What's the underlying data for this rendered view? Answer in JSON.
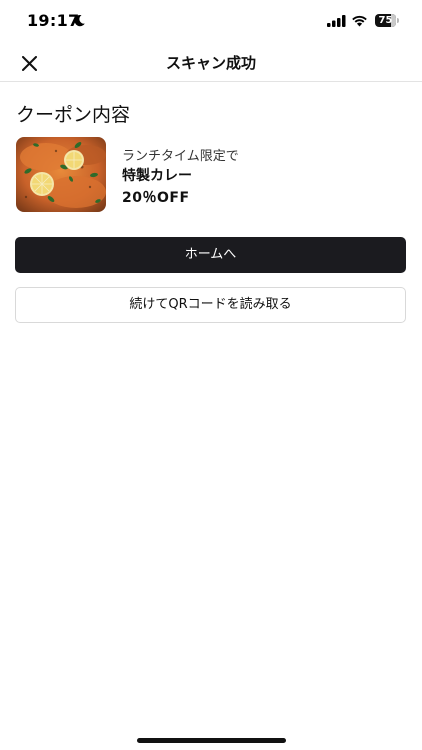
{
  "status_bar": {
    "time": "19:17",
    "battery": "75",
    "battery_level": 0.75
  },
  "nav": {
    "title": "スキャン成功"
  },
  "coupon": {
    "section_title": "クーポン内容",
    "subtitle": "ランチタイム限定で",
    "name": "特製カレー",
    "discount": "20％OFF",
    "image_icon": "curry-food-photo"
  },
  "actions": {
    "home_label": "ホームへ",
    "rescan_label": "続けてQRコードを読み取る"
  },
  "colors": {
    "primary_button": "#1b1b1f",
    "divider": "#e3e3e3"
  }
}
